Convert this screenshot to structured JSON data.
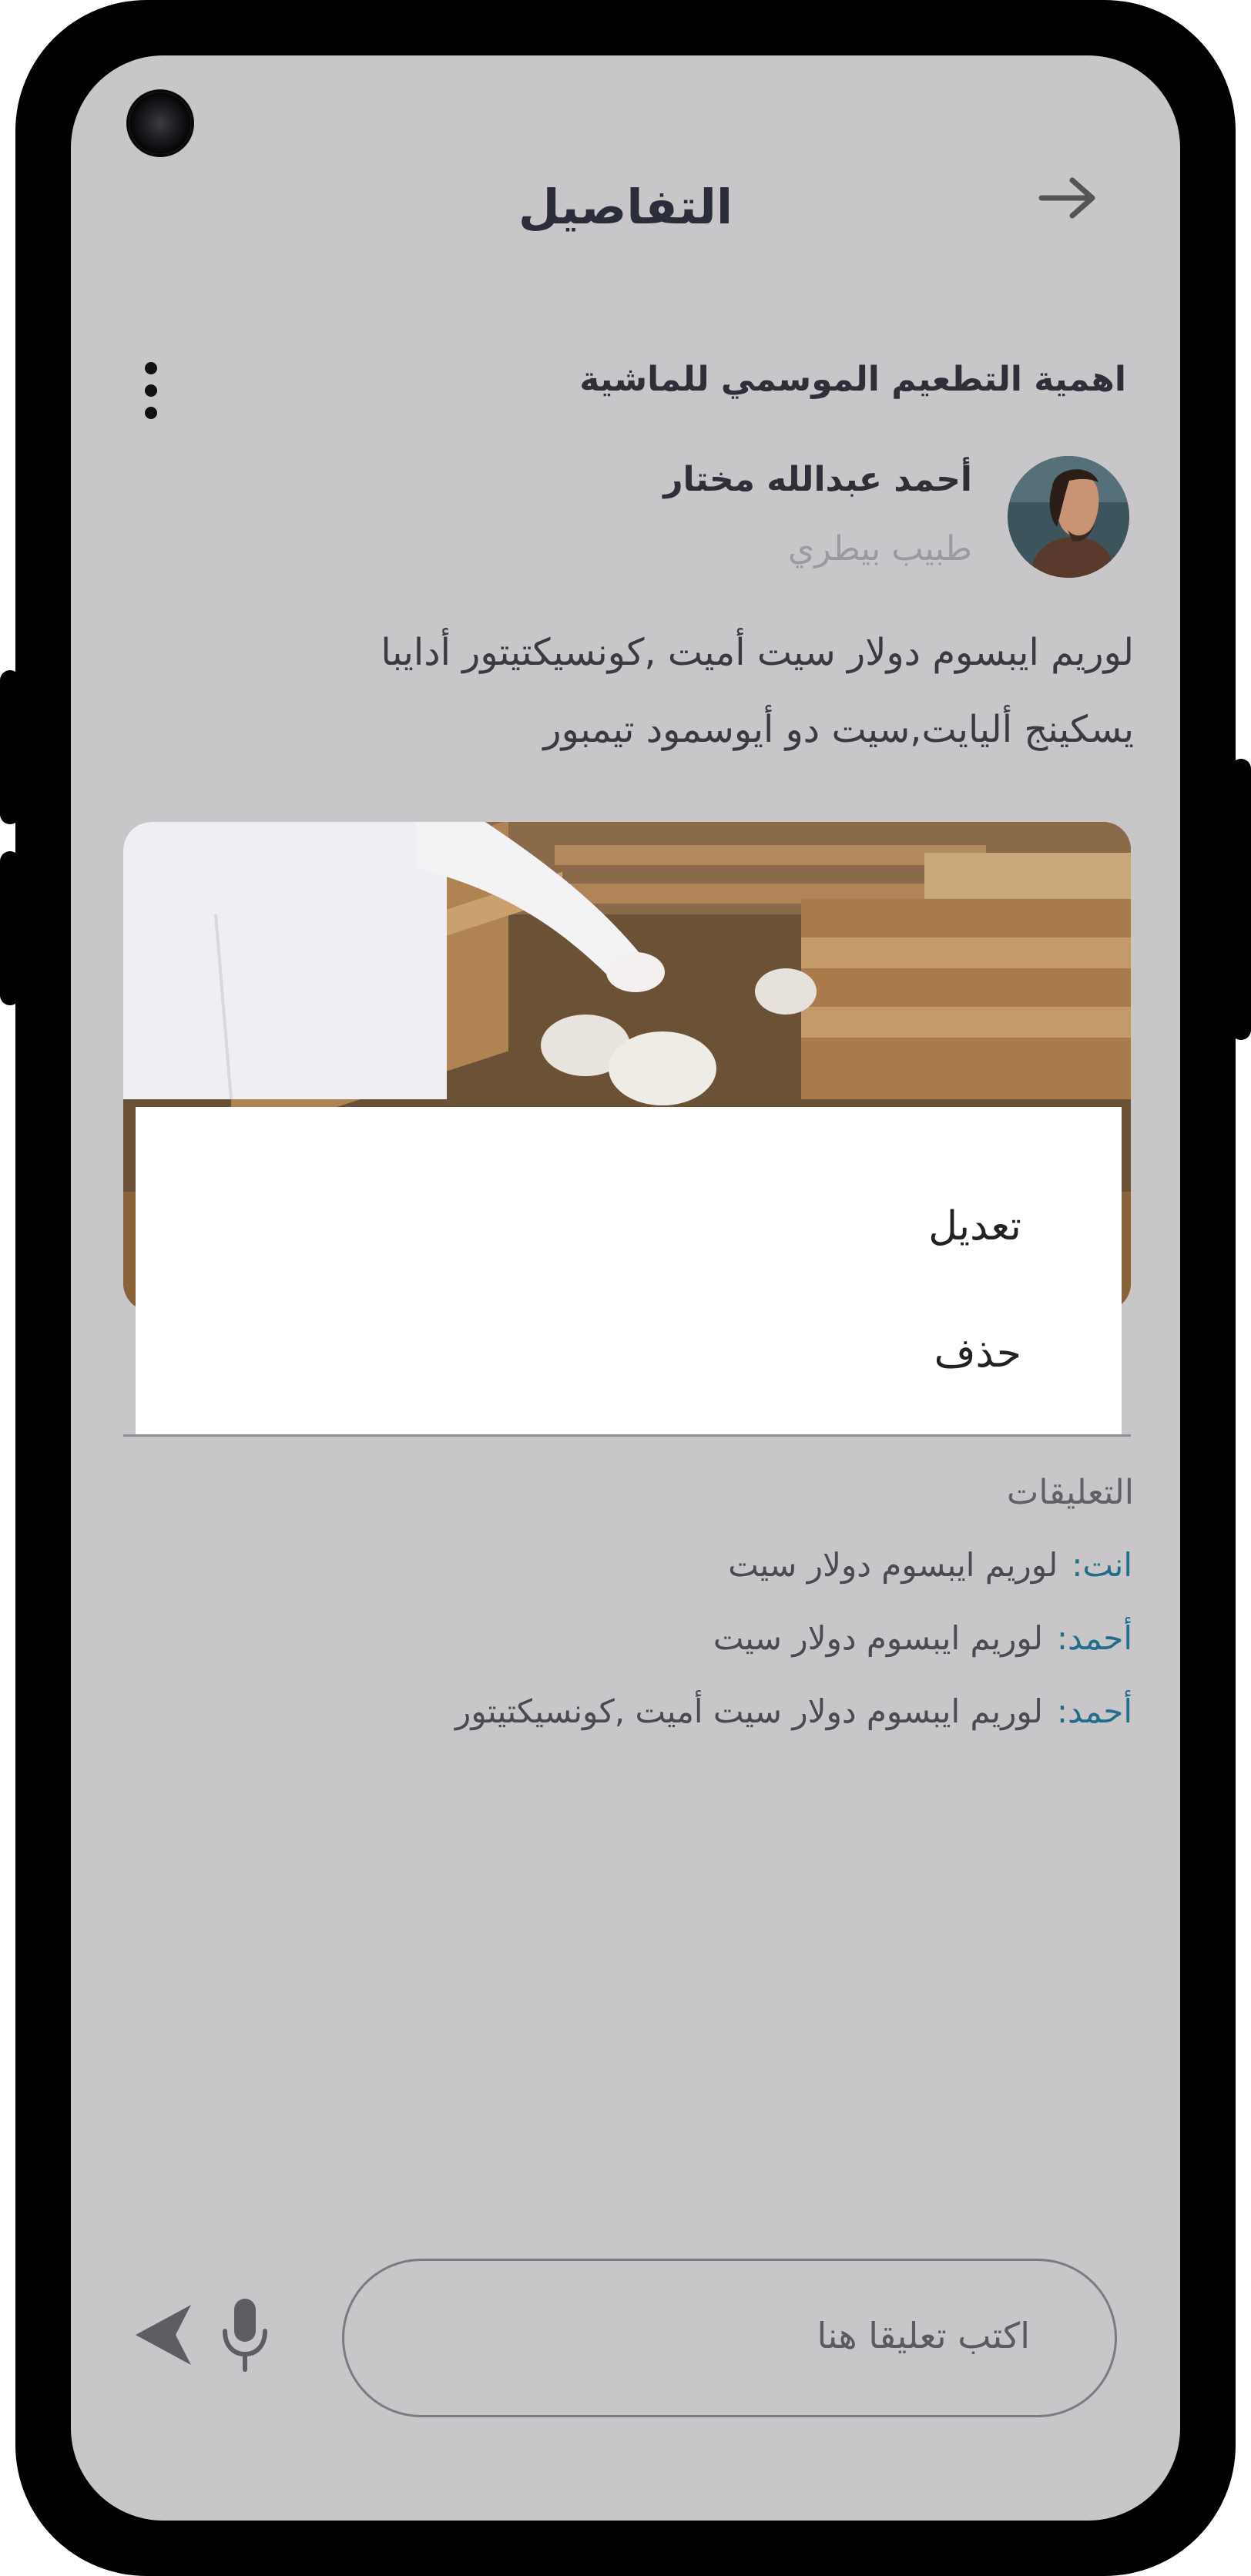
{
  "header": {
    "title": "التفاصيل",
    "back_icon": "arrow-right-icon"
  },
  "post": {
    "title": "اهمية التطعيم الموسمي للماشية",
    "author_name": "أحمد عبدالله مختار",
    "author_role": "طبيب بيطري",
    "body_line1": "لوريم ايبسوم دولار سيت أميت ,كونسيكتيتور أدايبا",
    "body_line2": "يسكينج أليايت,سيت دو أيوسمود تيمبور"
  },
  "menu": {
    "edit_label": "تعديل",
    "delete_label": "حذف"
  },
  "comments": {
    "title": "التعليقات",
    "items": [
      {
        "author": "انت:",
        "text": "لوريم ايبسوم دولار سيت"
      },
      {
        "author": "أحمد:",
        "text": "لوريم ايبسوم دولار سيت"
      },
      {
        "author": "أحمد:",
        "text": "لوريم ايبسوم دولار سيت أميت ,كونسيكتيتور"
      }
    ]
  },
  "composer": {
    "placeholder": "اكتب تعليقا هنا"
  },
  "colors": {
    "screen_bg": "#c8c6c8",
    "accent": "#1f6e8a",
    "menu_bg": "#ffffff"
  }
}
